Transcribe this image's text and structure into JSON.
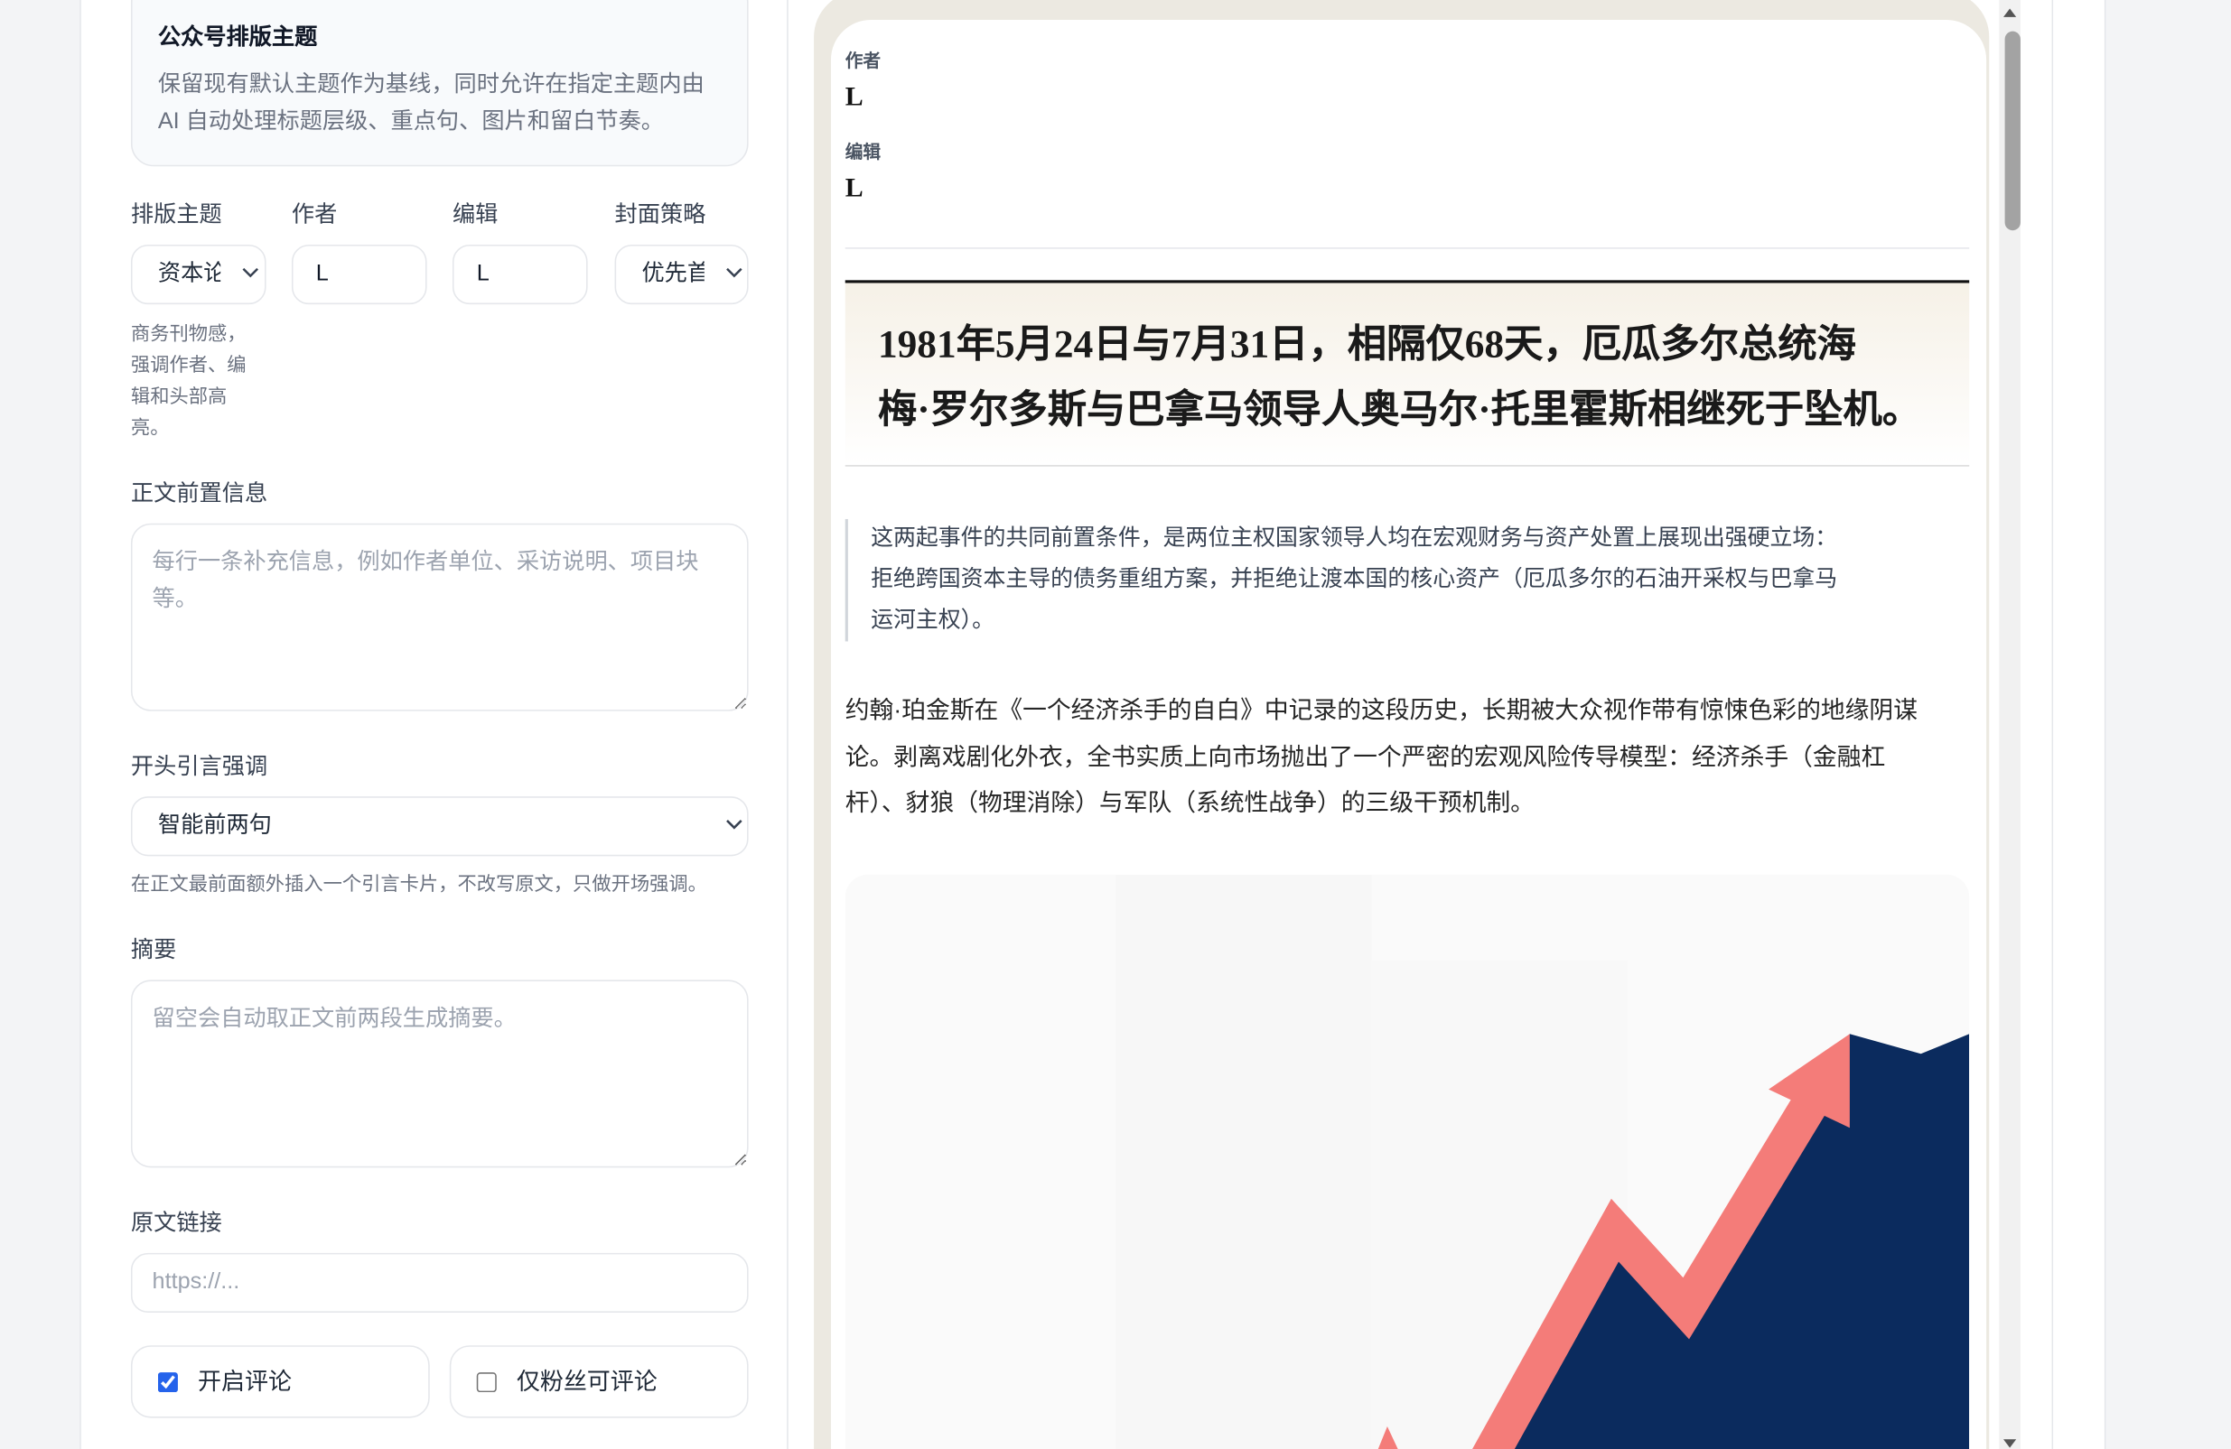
{
  "colors": {
    "accent": "#2563eb",
    "frame": "#ece9e1",
    "hero_area": "#0b2b5e",
    "hero_arrow": "#f47c79"
  },
  "settings": {
    "theme_card": {
      "title": "公众号排版主题",
      "description_lines": [
        "保留现有默认主题作为基线，同时允许在指定主题内由",
        "AI 自动处理标题层级、重点句、图片和留白节奏。"
      ]
    },
    "fields": {
      "theme": {
        "label": "排版主题",
        "value": "资本论",
        "hint_lines": [
          "商务刊物感，",
          "强调作者、编",
          "辑和头部高",
          "亮。"
        ]
      },
      "author": {
        "label": "作者",
        "value": "L"
      },
      "editor": {
        "label": "编辑",
        "value": "L"
      },
      "cover": {
        "label": "封面策略",
        "value": "优先首"
      }
    },
    "front_matter": {
      "label": "正文前置信息",
      "placeholder": "每行一条补充信息，例如作者单位、采访说明、项目块等。"
    },
    "lead_quote": {
      "label": "开头引言强调",
      "value": "智能前两句",
      "hint": "在正文最前面额外插入一个引言卡片，不改写原文，只做开场强调。"
    },
    "summary": {
      "label": "摘要",
      "placeholder": "留空会自动取正文前两段生成摘要。"
    },
    "source_link": {
      "label": "原文链接",
      "placeholder": "https://..."
    },
    "comments": {
      "enable": {
        "label": "开启评论",
        "checked": true
      },
      "fans_only": {
        "label": "仅粉丝可评论",
        "checked": false
      }
    }
  },
  "preview": {
    "byline": {
      "author_label": "作者",
      "author": "L",
      "editor_label": "编辑",
      "editor": "L"
    },
    "headline_lines": [
      "1981年5月24日与7月31日，相隔仅68天，厄瓜多尔总统海",
      "梅·罗尔多斯与巴拿马领导人奥马尔·托里霍斯相继死于坠机。"
    ],
    "quote_lines": [
      "这两起事件的共同前置条件，是两位主权国家领导人均在宏观财务与资产处置上展现出强硬立场：",
      "拒绝跨国资本主导的债务重组方案，并拒绝让渡本国的核心资产（厄瓜多尔的石油开采权与巴拿马",
      "运河主权）。"
    ],
    "paragraph_lines": [
      "约翰·珀金斯在《一个经济杀手的自白》中记录的这段历史，长期被大众视作带有惊悚色彩的地缘阴谋",
      "论。剥离戏剧化外衣，全书实质上向市场抛出了一个严密的宏观风险传导模型：经济杀手（金融杠",
      "杆）、豺狼（物理消除）与军队（系统性战争）的三级干预机制。"
    ]
  }
}
